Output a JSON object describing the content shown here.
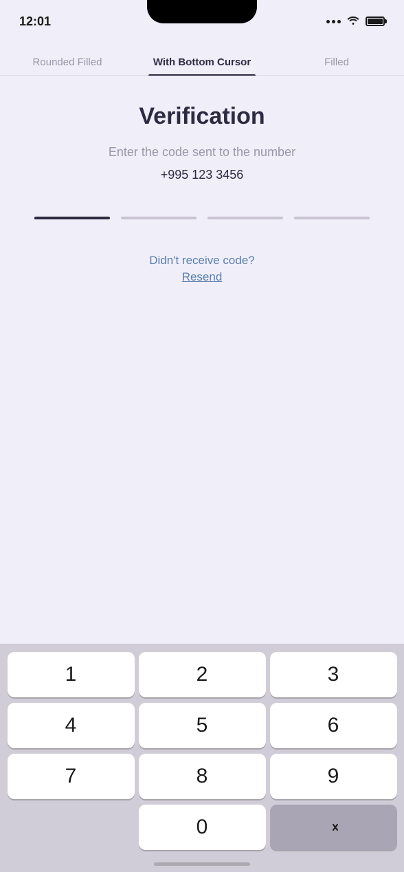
{
  "statusBar": {
    "time": "12:01"
  },
  "tabs": [
    {
      "id": "rounded-filled",
      "label": "Rounded Filled",
      "active": false
    },
    {
      "id": "with-bottom-cursor",
      "label": "With Bottom Cursor",
      "active": true
    },
    {
      "id": "filled",
      "label": "Filled",
      "active": false
    }
  ],
  "content": {
    "title": "Verification",
    "subtitle": "Enter the code sent to the number",
    "phoneNumber": "+995 123 3456",
    "otpFields": 4,
    "didntReceive": "Didn't receive code?",
    "resendLabel": "Resend"
  },
  "keyboard": {
    "keys": [
      [
        "1",
        "2",
        "3"
      ],
      [
        "4",
        "5",
        "6"
      ],
      [
        "7",
        "8",
        "9"
      ],
      [
        "",
        "0",
        "⌫"
      ]
    ]
  }
}
